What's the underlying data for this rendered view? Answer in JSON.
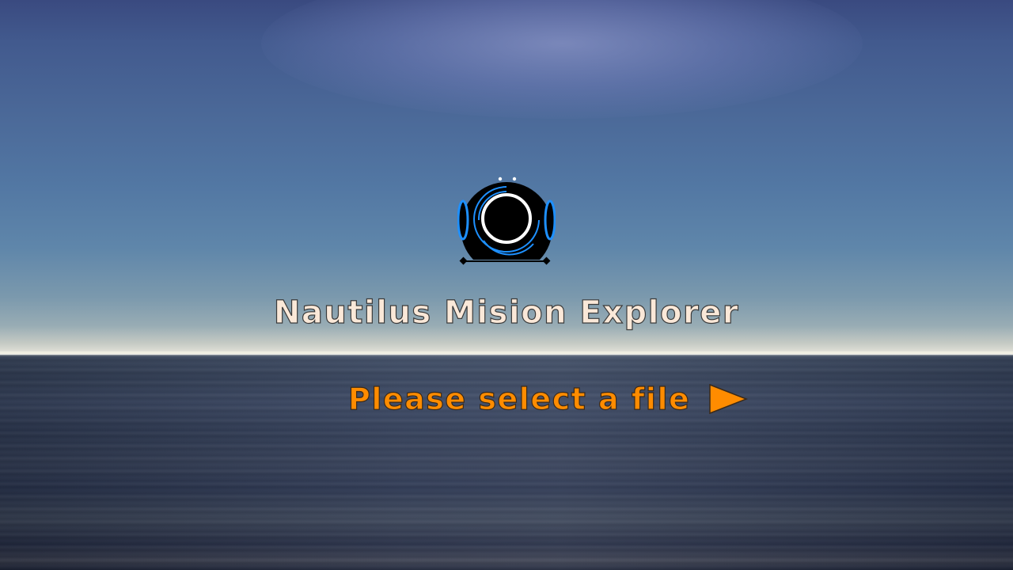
{
  "app": {
    "title": "Nautilus Mision Explorer",
    "logo_icon": "diving-helmet-icon"
  },
  "prompt": {
    "label": "Please select a file",
    "icon": "play-arrow-icon"
  },
  "colors": {
    "title_text": "#fae8d8",
    "prompt_text": "#ff8c00",
    "logo_accent": "#1e90ff",
    "logo_body": "#000000"
  }
}
